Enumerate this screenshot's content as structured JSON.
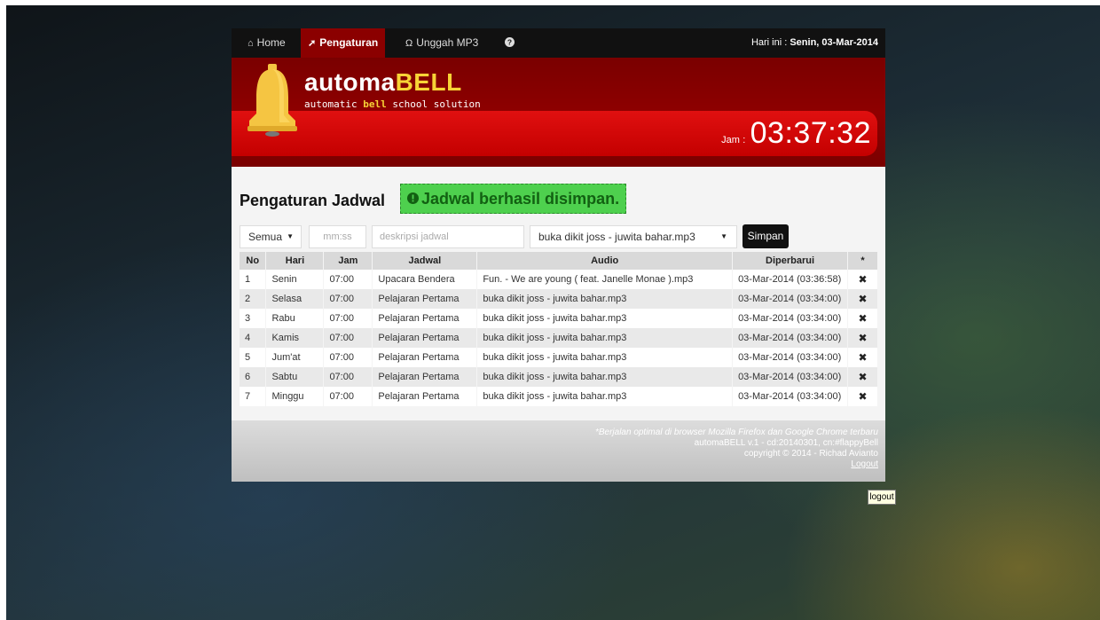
{
  "nav": {
    "items": [
      {
        "label": "Home",
        "icon": "home-icon"
      },
      {
        "label": "Pengaturan",
        "icon": "wrench-icon"
      },
      {
        "label": "Unggah MP3",
        "icon": "headphones-icon"
      },
      {
        "label": "",
        "icon": "help-icon"
      }
    ],
    "date_label": "Hari ini : ",
    "date_value": "Senin, 03-Mar-2014"
  },
  "brand": {
    "name_main": "automa",
    "name_accent": "BELL",
    "tagline_pre": "automatic ",
    "tagline_accent": "bell",
    "tagline_post": " school solution"
  },
  "clock": {
    "label": "Jam",
    "sep": ":",
    "time": "03:37:32"
  },
  "main": {
    "title": "Pengaturan Jadwal",
    "alert": "Jadwal berhasil disimpan."
  },
  "form": {
    "day_value": "Semua",
    "time_placeholder": "mm:ss",
    "desc_placeholder": "deskripsi jadwal",
    "audio_value": "buka dikit joss - juwita bahar.mp3",
    "save_label": "Simpan"
  },
  "table": {
    "headers": [
      "No",
      "Hari",
      "Jam",
      "Jadwal",
      "Audio",
      "Diperbarui",
      "*"
    ],
    "rows": [
      {
        "no": "1",
        "day": "Senin",
        "time": "07:00",
        "schedule": "Upacara Bendera",
        "audio": "Fun. - We are young ( feat. Janelle Monae ).mp3",
        "updated": "03-Mar-2014 (03:36:58)"
      },
      {
        "no": "2",
        "day": "Selasa",
        "time": "07:00",
        "schedule": "Pelajaran Pertama",
        "audio": "buka dikit joss - juwita bahar.mp3",
        "updated": "03-Mar-2014 (03:34:00)"
      },
      {
        "no": "3",
        "day": "Rabu",
        "time": "07:00",
        "schedule": "Pelajaran Pertama",
        "audio": "buka dikit joss - juwita bahar.mp3",
        "updated": "03-Mar-2014 (03:34:00)"
      },
      {
        "no": "4",
        "day": "Kamis",
        "time": "07:00",
        "schedule": "Pelajaran Pertama",
        "audio": "buka dikit joss - juwita bahar.mp3",
        "updated": "03-Mar-2014 (03:34:00)"
      },
      {
        "no": "5",
        "day": "Jum'at",
        "time": "07:00",
        "schedule": "Pelajaran Pertama",
        "audio": "buka dikit joss - juwita bahar.mp3",
        "updated": "03-Mar-2014 (03:34:00)"
      },
      {
        "no": "6",
        "day": "Sabtu",
        "time": "07:00",
        "schedule": "Pelajaran Pertama",
        "audio": "buka dikit joss - juwita bahar.mp3",
        "updated": "03-Mar-2014 (03:34:00)"
      },
      {
        "no": "7",
        "day": "Minggu",
        "time": "07:00",
        "schedule": "Pelajaran Pertama",
        "audio": "buka dikit joss - juwita bahar.mp3",
        "updated": "03-Mar-2014 (03:34:00)"
      }
    ]
  },
  "footer": {
    "note": "*Berjalan optimal di browser Mozilla Firefox dan Google Chrome terbaru",
    "version": "automaBELL v.1 - cd:20140301, cn:#flappyBell",
    "copyright": "copyright © 2014 - Richad Avianto",
    "logout": "Logout"
  },
  "tooltip": "logout",
  "colors": {
    "nav_bg": "#111111",
    "header_dark_red": "#8b0000",
    "header_band_red": "#e01010",
    "brand_yellow": "#f7d336",
    "alert_green": "#4ed04e"
  }
}
